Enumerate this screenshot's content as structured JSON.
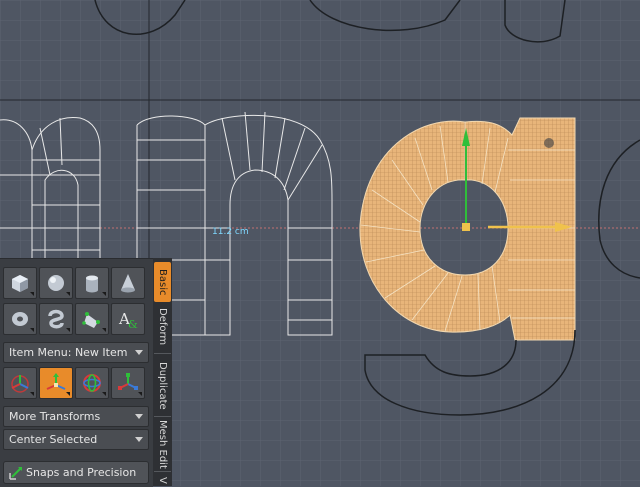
{
  "viewport": {
    "measurement_label": "11.2 cm",
    "background_color": "#4f5663",
    "selection_color": "#e8b57a"
  },
  "tool_panel": {
    "icon_rows": [
      [
        {
          "name": "cube-icon",
          "active": false
        },
        {
          "name": "sphere-icon",
          "active": false
        },
        {
          "name": "cylinder-icon",
          "active": false
        },
        {
          "name": "cone-icon",
          "active": false
        }
      ],
      [
        {
          "name": "torus-icon",
          "active": false
        },
        {
          "name": "capsule-icon",
          "active": false
        },
        {
          "name": "pen-tool-icon",
          "active": false
        },
        {
          "name": "text-tool-icon",
          "active": false
        }
      ],
      [
        {
          "name": "move-gizmo-icon",
          "active": false
        },
        {
          "name": "move-gizmo-icon",
          "active": true
        },
        {
          "name": "rotate-gizmo-icon",
          "active": false
        },
        {
          "name": "scale-gizmo-icon",
          "active": false
        }
      ]
    ],
    "item_menu_dropdown": "Item Menu: New Item",
    "more_transforms_dropdown": "More Transforms",
    "center_selected_dropdown": "Center Selected",
    "snaps_button": "Snaps and Precision"
  },
  "tabs": [
    {
      "label": "Basic",
      "active": true
    },
    {
      "label": "Deform",
      "active": false
    },
    {
      "label": "Duplicate",
      "active": false
    },
    {
      "label": "Mesh Edit",
      "active": false
    },
    {
      "label": "V",
      "active": false
    }
  ]
}
